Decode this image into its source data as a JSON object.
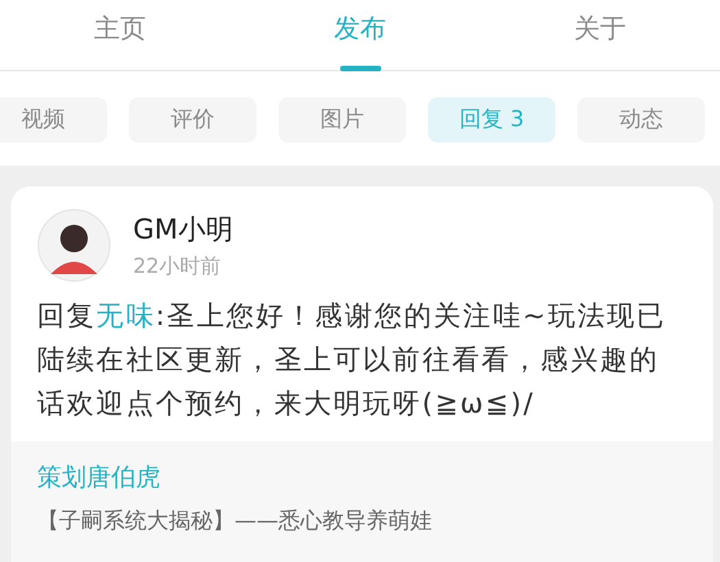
{
  "tabs": [
    {
      "label": "主页",
      "selected": false
    },
    {
      "label": "发布",
      "selected": true
    },
    {
      "label": "关于",
      "selected": false
    }
  ],
  "filters": [
    {
      "label": "视频",
      "selected": false
    },
    {
      "label": "评价",
      "selected": false
    },
    {
      "label": "图片",
      "selected": false
    },
    {
      "label": "回复 3",
      "selected": true
    },
    {
      "label": "动态",
      "selected": false
    }
  ],
  "post": {
    "author": "GM小明",
    "time": "22小时前",
    "reply_prefix": "回复",
    "reply_target": "无味",
    "text": ":圣上您好！感谢您的关注哇~玩法现已陆续在社区更新，圣上可以前往看看，感兴趣的话欢迎点个预约，来大明玩呀(≧ω≦)/",
    "quote": {
      "author": "策划唐伯虎",
      "title": "【子嗣系统大揭秘】——悉心教导养萌娃"
    }
  }
}
